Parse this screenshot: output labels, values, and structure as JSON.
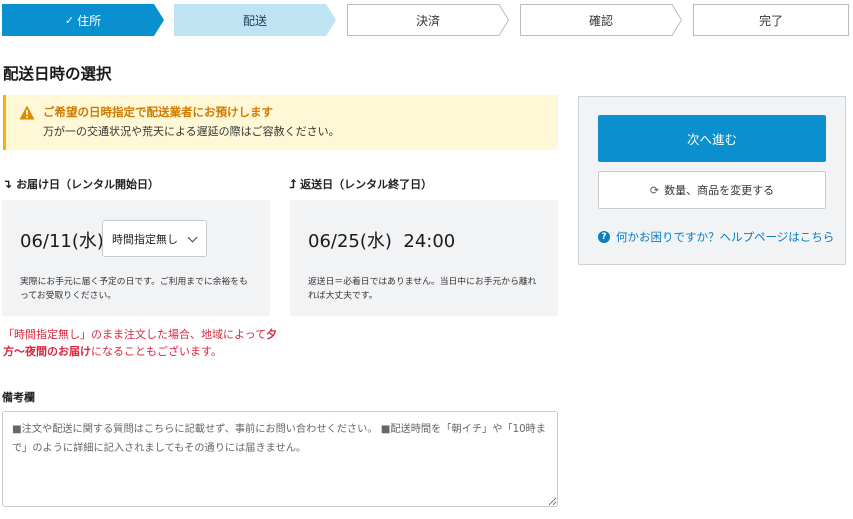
{
  "steps": [
    {
      "label": "住所",
      "state": "done",
      "icon": "check-icon"
    },
    {
      "label": "配送",
      "state": "current"
    },
    {
      "label": "決済",
      "state": "todo"
    },
    {
      "label": "確認",
      "state": "todo"
    },
    {
      "label": "完了",
      "state": "todo"
    }
  ],
  "colors": {
    "step_done": "#0a8fcf",
    "step_current": "#bfe3f3",
    "accent": "#0a8fcf",
    "warning": "#d27a00",
    "alert": "#d9263f"
  },
  "page_title": "配送日時の選択",
  "notice": {
    "icon": "warning-icon",
    "title": "ご希望の日時指定で配送業者にお預けします",
    "body": "万が一の交通状況や荒天による遅延の際はご容赦ください。"
  },
  "delivery": {
    "icon": "arrow-down-icon",
    "label": "お届け日（レンタル開始日）",
    "date": "06/11(水)",
    "time_select": "時間指定無し",
    "note": "実際にお手元に届く予定の日です。ご利用までに余裕をもってお受取りください。"
  },
  "return": {
    "icon": "arrow-up-icon",
    "label": "返送日（レンタル終了日）",
    "date": "06/25(水)  24:00",
    "note": "返送日＝必着日ではありません。当日中にお手元から離れれば大丈夫です。"
  },
  "red_note": {
    "part1": "「時間指定無し」のまま注文した場合、地域によって",
    "bold": "夕方〜夜間のお届け",
    "part2": "になることもございます。"
  },
  "remarks": {
    "label": "備考欄",
    "value": "",
    "placeholder": "■注文や配送に関する質問はこちらに記載せず、事前にお問い合わせください。 ■配送時間を「朝イチ」や「10時まで」のように詳細に記入されましてもその通りには届きません。"
  },
  "sidebar": {
    "next_label": "次へ進む",
    "change_label": "数量、商品を変更する",
    "change_icon": "refresh-icon",
    "help_icon": "question-icon",
    "help_link": "何かお困りですか？ヘルプページはこちら"
  }
}
